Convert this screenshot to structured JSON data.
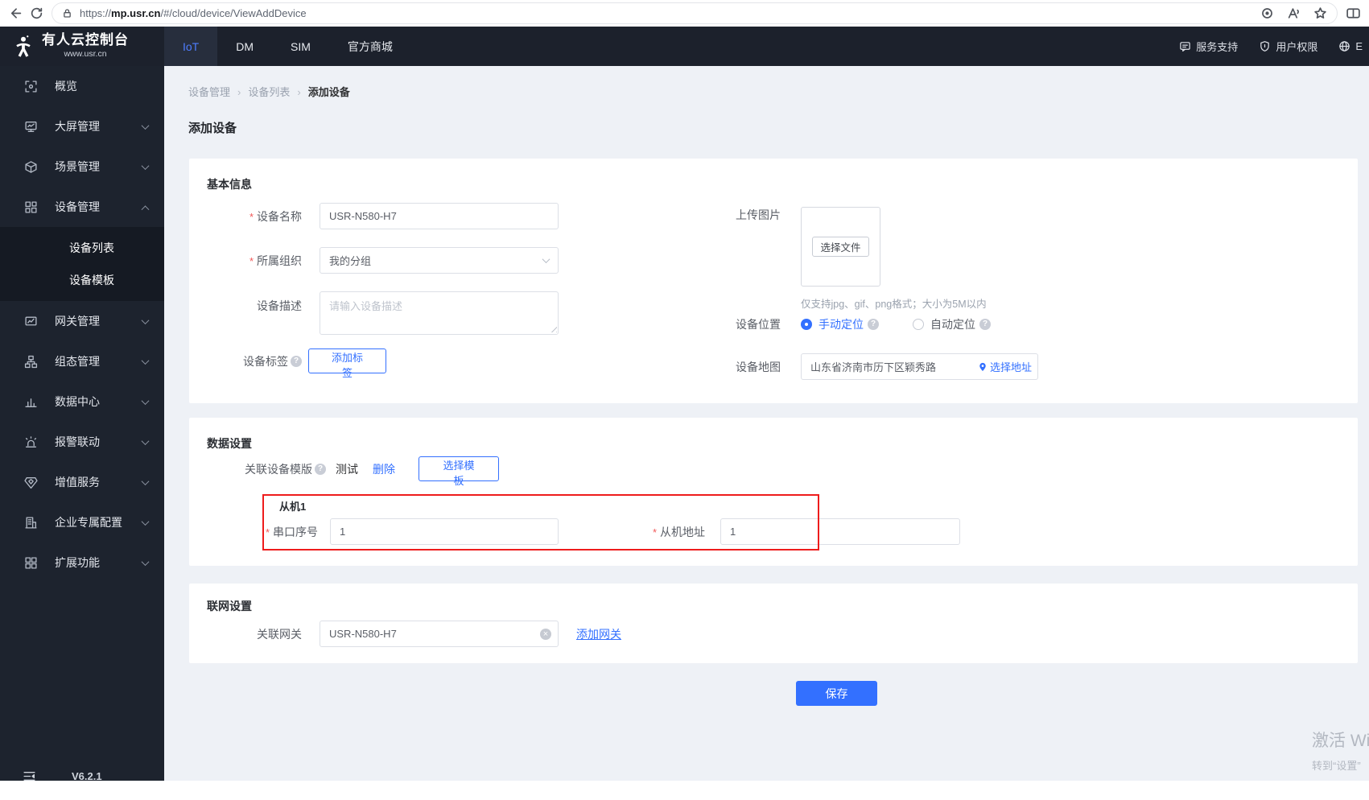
{
  "colors": {
    "accent": "#3370ff",
    "sidebar_bg": "#1d232e",
    "annotation_red": "#ee1c1c"
  },
  "browser": {
    "url_prefix": "https://",
    "url_host": "mp.usr.cn",
    "url_path": "/#/cloud/device/ViewAddDevice"
  },
  "navbar": {
    "logo_title": "有人云控制台",
    "logo_subtitle": "www.usr.cn",
    "tabs": [
      {
        "label": "IoT"
      },
      {
        "label": "DM"
      },
      {
        "label": "SIM"
      },
      {
        "label": "官方商城"
      }
    ],
    "support": "服务支持",
    "permissions": "用户权限",
    "lang": "E"
  },
  "sidebar": {
    "items": [
      {
        "label": "概览"
      },
      {
        "label": "大屏管理"
      },
      {
        "label": "场景管理"
      },
      {
        "label": "设备管理"
      },
      {
        "label": "网关管理"
      },
      {
        "label": "组态管理"
      },
      {
        "label": "数据中心"
      },
      {
        "label": "报警联动"
      },
      {
        "label": "增值服务"
      },
      {
        "label": "企业专属配置"
      },
      {
        "label": "扩展功能"
      }
    ],
    "submenu": [
      {
        "label": "设备列表"
      },
      {
        "label": "设备模板"
      }
    ],
    "version": "V6.2.1"
  },
  "breadcrumb": {
    "0": "设备管理",
    "1": "设备列表",
    "2": "添加设备"
  },
  "page_title": "添加设备",
  "basic_info": {
    "title": "基本信息",
    "device_name_label": "设备名称",
    "device_name_value": "USR-N580-H7",
    "org_label": "所属组织",
    "org_value": "我的分组",
    "desc_label": "设备描述",
    "desc_placeholder": "请输入设备描述",
    "tag_label": "设备标签",
    "add_tag_button": "添加标签",
    "upload_label": "上传图片",
    "choose_file_button": "选择文件",
    "upload_hint": "仅支持jpg、gif、png格式；大小为5M以内",
    "location_label": "设备位置",
    "manual_location": "手动定位",
    "auto_location": "自动定位",
    "map_label": "设备地图",
    "map_value": "山东省济南市历下区颖秀路",
    "choose_address": "选择地址"
  },
  "data_settings": {
    "title": "数据设置",
    "template_label": "关联设备模版",
    "template_name": "测试",
    "delete_link": "删除",
    "choose_template_button": "选择模板",
    "slave_title": "从机1",
    "serial_label": "串口序号",
    "serial_value": "1",
    "slave_addr_label": "从机地址",
    "slave_addr_value": "1"
  },
  "network_settings": {
    "title": "联网设置",
    "gateway_label": "关联网关",
    "gateway_value": "USR-N580-H7",
    "add_gateway_link": "添加网关"
  },
  "save_button": "保存",
  "watermark": {
    "line1": "激活 Wi",
    "line2": "转到“设置”"
  }
}
